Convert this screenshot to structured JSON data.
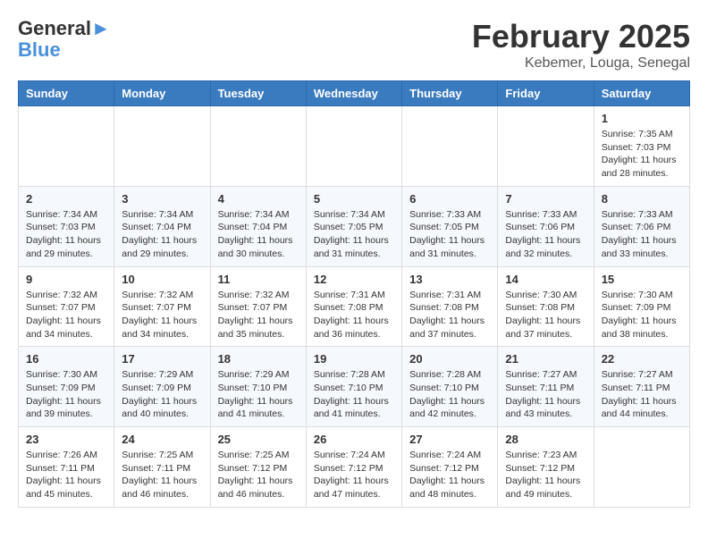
{
  "logo": {
    "line1": "General",
    "line2": "Blue"
  },
  "title": "February 2025",
  "subtitle": "Kebemer, Louga, Senegal",
  "weekdays": [
    "Sunday",
    "Monday",
    "Tuesday",
    "Wednesday",
    "Thursday",
    "Friday",
    "Saturday"
  ],
  "weeks": [
    [
      {
        "day": "",
        "info": ""
      },
      {
        "day": "",
        "info": ""
      },
      {
        "day": "",
        "info": ""
      },
      {
        "day": "",
        "info": ""
      },
      {
        "day": "",
        "info": ""
      },
      {
        "day": "",
        "info": ""
      },
      {
        "day": "1",
        "info": "Sunrise: 7:35 AM\nSunset: 7:03 PM\nDaylight: 11 hours\nand 28 minutes."
      }
    ],
    [
      {
        "day": "2",
        "info": "Sunrise: 7:34 AM\nSunset: 7:03 PM\nDaylight: 11 hours\nand 29 minutes."
      },
      {
        "day": "3",
        "info": "Sunrise: 7:34 AM\nSunset: 7:04 PM\nDaylight: 11 hours\nand 29 minutes."
      },
      {
        "day": "4",
        "info": "Sunrise: 7:34 AM\nSunset: 7:04 PM\nDaylight: 11 hours\nand 30 minutes."
      },
      {
        "day": "5",
        "info": "Sunrise: 7:34 AM\nSunset: 7:05 PM\nDaylight: 11 hours\nand 31 minutes."
      },
      {
        "day": "6",
        "info": "Sunrise: 7:33 AM\nSunset: 7:05 PM\nDaylight: 11 hours\nand 31 minutes."
      },
      {
        "day": "7",
        "info": "Sunrise: 7:33 AM\nSunset: 7:06 PM\nDaylight: 11 hours\nand 32 minutes."
      },
      {
        "day": "8",
        "info": "Sunrise: 7:33 AM\nSunset: 7:06 PM\nDaylight: 11 hours\nand 33 minutes."
      }
    ],
    [
      {
        "day": "9",
        "info": "Sunrise: 7:32 AM\nSunset: 7:07 PM\nDaylight: 11 hours\nand 34 minutes."
      },
      {
        "day": "10",
        "info": "Sunrise: 7:32 AM\nSunset: 7:07 PM\nDaylight: 11 hours\nand 34 minutes."
      },
      {
        "day": "11",
        "info": "Sunrise: 7:32 AM\nSunset: 7:07 PM\nDaylight: 11 hours\nand 35 minutes."
      },
      {
        "day": "12",
        "info": "Sunrise: 7:31 AM\nSunset: 7:08 PM\nDaylight: 11 hours\nand 36 minutes."
      },
      {
        "day": "13",
        "info": "Sunrise: 7:31 AM\nSunset: 7:08 PM\nDaylight: 11 hours\nand 37 minutes."
      },
      {
        "day": "14",
        "info": "Sunrise: 7:30 AM\nSunset: 7:08 PM\nDaylight: 11 hours\nand 37 minutes."
      },
      {
        "day": "15",
        "info": "Sunrise: 7:30 AM\nSunset: 7:09 PM\nDaylight: 11 hours\nand 38 minutes."
      }
    ],
    [
      {
        "day": "16",
        "info": "Sunrise: 7:30 AM\nSunset: 7:09 PM\nDaylight: 11 hours\nand 39 minutes."
      },
      {
        "day": "17",
        "info": "Sunrise: 7:29 AM\nSunset: 7:09 PM\nDaylight: 11 hours\nand 40 minutes."
      },
      {
        "day": "18",
        "info": "Sunrise: 7:29 AM\nSunset: 7:10 PM\nDaylight: 11 hours\nand 41 minutes."
      },
      {
        "day": "19",
        "info": "Sunrise: 7:28 AM\nSunset: 7:10 PM\nDaylight: 11 hours\nand 41 minutes."
      },
      {
        "day": "20",
        "info": "Sunrise: 7:28 AM\nSunset: 7:10 PM\nDaylight: 11 hours\nand 42 minutes."
      },
      {
        "day": "21",
        "info": "Sunrise: 7:27 AM\nSunset: 7:11 PM\nDaylight: 11 hours\nand 43 minutes."
      },
      {
        "day": "22",
        "info": "Sunrise: 7:27 AM\nSunset: 7:11 PM\nDaylight: 11 hours\nand 44 minutes."
      }
    ],
    [
      {
        "day": "23",
        "info": "Sunrise: 7:26 AM\nSunset: 7:11 PM\nDaylight: 11 hours\nand 45 minutes."
      },
      {
        "day": "24",
        "info": "Sunrise: 7:25 AM\nSunset: 7:11 PM\nDaylight: 11 hours\nand 46 minutes."
      },
      {
        "day": "25",
        "info": "Sunrise: 7:25 AM\nSunset: 7:12 PM\nDaylight: 11 hours\nand 46 minutes."
      },
      {
        "day": "26",
        "info": "Sunrise: 7:24 AM\nSunset: 7:12 PM\nDaylight: 11 hours\nand 47 minutes."
      },
      {
        "day": "27",
        "info": "Sunrise: 7:24 AM\nSunset: 7:12 PM\nDaylight: 11 hours\nand 48 minutes."
      },
      {
        "day": "28",
        "info": "Sunrise: 7:23 AM\nSunset: 7:12 PM\nDaylight: 11 hours\nand 49 minutes."
      },
      {
        "day": "",
        "info": ""
      }
    ]
  ]
}
